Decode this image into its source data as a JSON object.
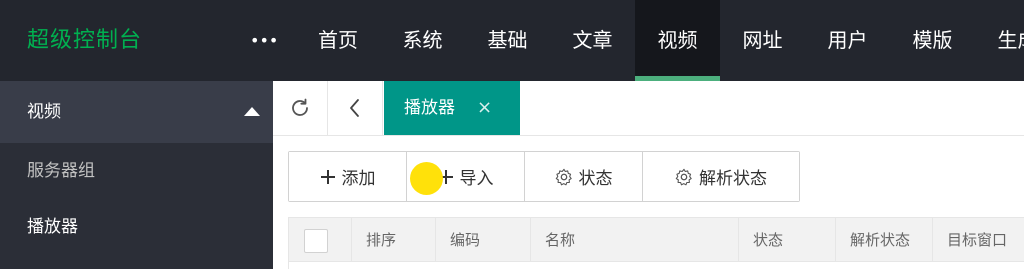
{
  "header": {
    "logo": "超级控制台",
    "more_label": "•••",
    "nav": [
      "首页",
      "系统",
      "基础",
      "文章",
      "视频",
      "网址",
      "用户",
      "模版",
      "生成"
    ],
    "active_index": 4
  },
  "sidebar": {
    "section_title": "视频",
    "items": [
      "服务器组",
      "播放器"
    ]
  },
  "tabs": {
    "active_label": "播放器",
    "close_symbol": "×"
  },
  "toolbar": {
    "add_label": "添加",
    "import_label": "导入",
    "status_label": "状态",
    "parse_status_label": "解析状态"
  },
  "table": {
    "columns": [
      "排序",
      "编码",
      "名称",
      "状态",
      "解析状态",
      "目标窗口"
    ]
  },
  "icons": {
    "refresh": "refresh-icon",
    "back": "chevron-left-icon",
    "add": "plus-icon",
    "import": "plus-icon",
    "status": "gear-icon",
    "parse_status": "gear-icon",
    "section_toggle": "caret-up-icon"
  },
  "colors": {
    "header_bg": "#23262e",
    "logo": "#00b050",
    "active_tab": "#009688",
    "nav_active_underline": "#4caf7d",
    "sidebar_bg": "#2b2e37"
  }
}
